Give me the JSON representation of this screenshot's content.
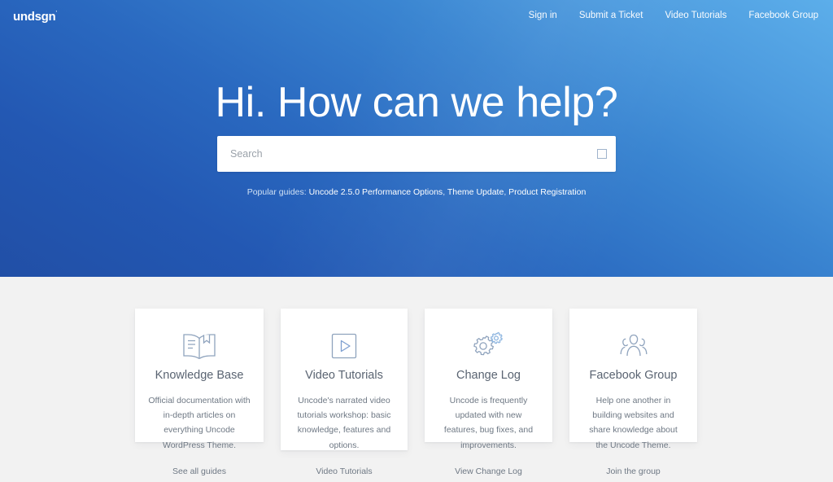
{
  "header": {
    "logo_text": "undsgn",
    "logo_tm": "’",
    "nav": [
      {
        "label": "Sign in",
        "name": "nav-sign-in"
      },
      {
        "label": "Submit a Ticket",
        "name": "nav-submit-a-ticket"
      },
      {
        "label": "Video Tutorials",
        "name": "nav-video-tutorials"
      },
      {
        "label": "Facebook Group",
        "name": "nav-facebook-group"
      }
    ]
  },
  "hero": {
    "title": "Hi. How can we help?",
    "search": {
      "placeholder": "Search",
      "value": "",
      "icon": "search-icon"
    },
    "popular": {
      "label": "Popular guides:",
      "links": [
        "Uncode 2.5.0 Performance Options",
        "Theme Update",
        "Product Registration"
      ],
      "separator": ", "
    },
    "colors": {
      "gradient_start": "#214fa6",
      "gradient_end": "#5caeea"
    }
  },
  "cards": [
    {
      "icon": "open-book-icon",
      "title": "Knowledge Base",
      "description": "Official documentation with in-depth articles on everything Uncode WordPress Theme.",
      "link_label": "See all guides"
    },
    {
      "icon": "play-video-icon",
      "title": "Video Tutorials",
      "description": "Uncode's narrated video tutorials workshop: basic knowledge, features and options.",
      "link_label": "Video Tutorials"
    },
    {
      "icon": "gears-icon",
      "title": "Change Log",
      "description": "Uncode is frequently updated with new features, bug fixes, and improvements.",
      "link_label": "View Change Log"
    },
    {
      "icon": "people-group-icon",
      "title": "Facebook Group",
      "description": "Help one another in building websites and share knowledge about the Uncode Theme.",
      "link_label": "Join the group"
    }
  ],
  "page": {
    "background": "#f2f2f2",
    "icon_color": "#8fa3bd"
  }
}
